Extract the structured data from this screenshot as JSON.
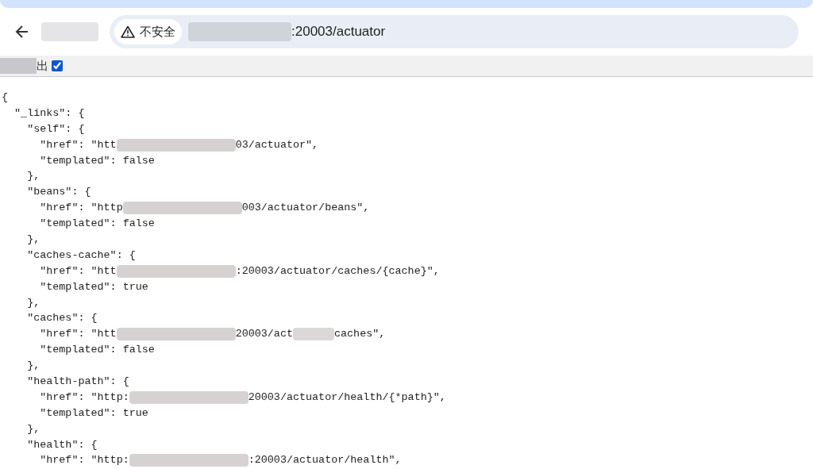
{
  "browser": {
    "address_security": "不安全",
    "address_tail": ":20003/actuator"
  },
  "toolbar": {
    "label": "出",
    "checked": true
  },
  "lines": [
    {
      "parts": [
        {
          "text": "{"
        }
      ]
    },
    {
      "parts": [
        {
          "text": "  \"_links\": {"
        }
      ]
    },
    {
      "parts": [
        {
          "text": "    \"self\": {"
        }
      ]
    },
    {
      "parts": [
        {
          "text": "      \"href\": \"htt"
        },
        {
          "kind": "redacted"
        },
        {
          "text": "03/actuator\","
        }
      ]
    },
    {
      "parts": [
        {
          "text": "      \"templated\": false"
        }
      ]
    },
    {
      "parts": [
        {
          "text": "    },"
        }
      ]
    },
    {
      "parts": [
        {
          "text": "    \"beans\": {"
        }
      ]
    },
    {
      "parts": [
        {
          "text": "      \"href\": \"http"
        },
        {
          "kind": "redacted"
        },
        {
          "text": "003/actuator/beans\","
        }
      ]
    },
    {
      "parts": [
        {
          "text": "      \"templated\": false"
        }
      ]
    },
    {
      "parts": [
        {
          "text": "    },"
        }
      ]
    },
    {
      "parts": [
        {
          "text": "    \"caches-cache\": {"
        }
      ]
    },
    {
      "parts": [
        {
          "text": "      \"href\": \"htt"
        },
        {
          "kind": "redacted"
        },
        {
          "text": ":20003/actuator/caches/{cache}\","
        }
      ]
    },
    {
      "parts": [
        {
          "text": "      \"templated\": true"
        }
      ]
    },
    {
      "parts": [
        {
          "text": "    },"
        }
      ]
    },
    {
      "parts": [
        {
          "text": "    \"caches\": {"
        }
      ]
    },
    {
      "parts": [
        {
          "text": "      \"href\": \"htt"
        },
        {
          "kind": "redacted"
        },
        {
          "text": "20003/act"
        },
        {
          "kind": "redacted_short"
        },
        {
          "text": "caches\","
        }
      ]
    },
    {
      "parts": [
        {
          "text": "      \"templated\": false"
        }
      ]
    },
    {
      "parts": [
        {
          "text": "    },"
        }
      ]
    },
    {
      "parts": [
        {
          "text": "    \"health-path\": {"
        }
      ]
    },
    {
      "parts": [
        {
          "text": "      \"href\": \"http:"
        },
        {
          "kind": "redacted"
        },
        {
          "text": "20003/actuator/health/{*path}\","
        }
      ]
    },
    {
      "parts": [
        {
          "text": "      \"templated\": true"
        }
      ]
    },
    {
      "parts": [
        {
          "text": "    },"
        }
      ]
    },
    {
      "parts": [
        {
          "text": "    \"health\": {"
        }
      ]
    },
    {
      "parts": [
        {
          "text": "      \"href\": \"http:"
        },
        {
          "kind": "redacted"
        },
        {
          "text": ":20003/actuator/health\","
        }
      ]
    }
  ]
}
